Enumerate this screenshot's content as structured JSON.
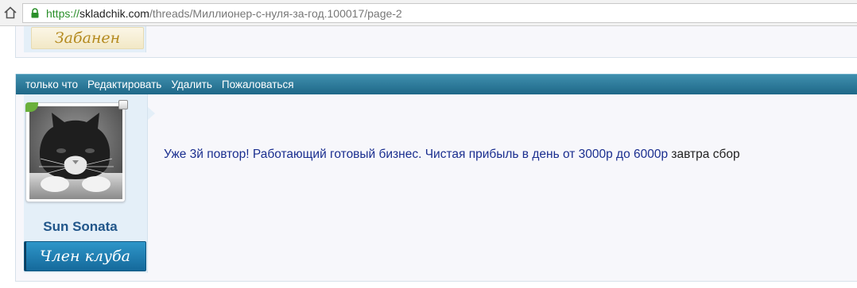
{
  "browser": {
    "url_scheme": "https://",
    "url_host": "skladchik.com",
    "url_path": "/threads/Миллионер-с-нуля-за-год.100017/page-2"
  },
  "prev_post": {
    "user_title": "Забанен"
  },
  "post": {
    "actions": [
      "только что",
      "Редактировать",
      "Удалить",
      "Пожаловаться"
    ],
    "author": {
      "name": "Sun Sonata",
      "title": "Член клуба"
    },
    "message": {
      "link_text": "Уже 3й повтор! Работающий готовый бизнес. Чистая прибыль в день от 3000р до 6000р",
      "plain_text": " завтра сбор"
    }
  },
  "colors": {
    "bar_top": "#3f8fae",
    "bar_bottom": "#1f6888",
    "username": "#21568a",
    "link": "#1a2e8f",
    "rank_badge": "#1f7fb4",
    "banned_text": "#b48a1f"
  }
}
